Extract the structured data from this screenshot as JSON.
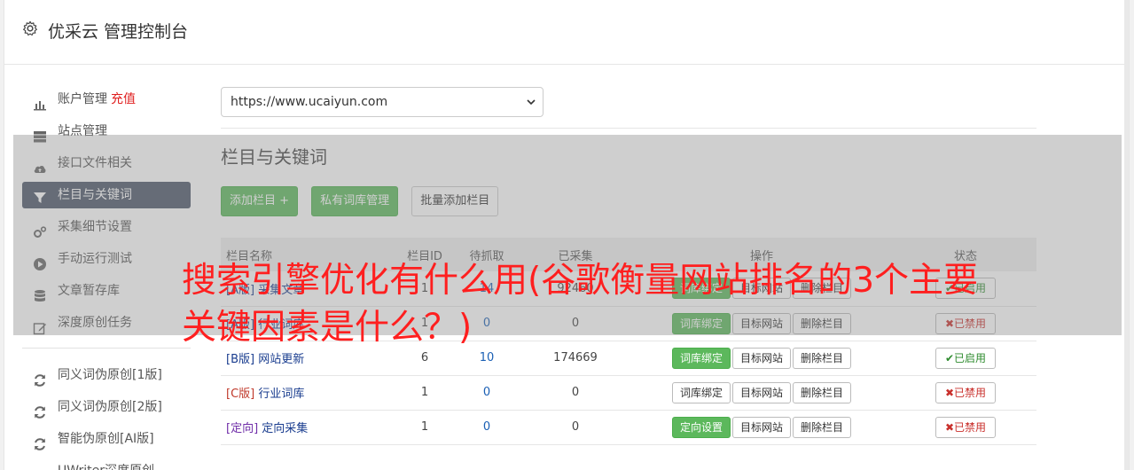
{
  "header": {
    "title": "优采云 管理控制台"
  },
  "sidebar": {
    "items": [
      {
        "label": "账户管理",
        "extra": "充值",
        "icon": "bar-chart-icon"
      },
      {
        "label": "站点管理",
        "icon": "server-icon"
      },
      {
        "label": "接口文件相关",
        "icon": "cloud-upload-icon"
      },
      {
        "label": "栏目与关键词",
        "icon": "filter-icon",
        "active": true
      },
      {
        "label": "采集细节设置",
        "icon": "cogs-icon"
      },
      {
        "label": "手动运行测试",
        "icon": "play-circle-icon"
      },
      {
        "label": "文章暂存库",
        "icon": "database-icon"
      },
      {
        "label": "深度原创任务",
        "icon": "edit-icon"
      }
    ],
    "items2": [
      {
        "label": "同义词伪原创[1版]",
        "icon": "refresh-icon"
      },
      {
        "label": "同义词伪原创[2版]",
        "icon": "refresh-icon"
      },
      {
        "label": "智能伪原创[AI版]",
        "icon": "refresh-icon"
      },
      {
        "label": "UWriter深度原创",
        "icon": "edit-icon"
      }
    ]
  },
  "main": {
    "site_select": "https://www.ucaiyun.com",
    "section_title": "栏目与关键词",
    "buttons": {
      "add": "添加栏目 +",
      "private_lib": "私有词库管理",
      "batch_add": "批量添加栏目"
    },
    "table": {
      "headers": [
        "栏目名称",
        "栏目ID",
        "待抓取",
        "已采集",
        "操作",
        "状态"
      ],
      "rows": [
        {
          "tag": "[A版]",
          "name": "采集文章",
          "id": "1",
          "pending": "14",
          "collected": "92460",
          "op1": "词库绑定",
          "op1_green": true,
          "op2": "目标网站",
          "op3": "删除栏目",
          "status": "✔已启用",
          "on": true
        },
        {
          "tag": "[A版]",
          "name": "行业词库",
          "id": "1",
          "pending": "0",
          "collected": "0",
          "op1": "词库绑定",
          "op1_green": true,
          "op2": "目标网站",
          "op3": "删除栏目",
          "status": "✖已禁用",
          "on": false
        },
        {
          "tag": "[B版]",
          "name": "网站更新",
          "id": "6",
          "pending": "10",
          "collected": "174669",
          "op1": "词库绑定",
          "op1_green": true,
          "op2": "目标网站",
          "op3": "删除栏目",
          "status": "✔已启用",
          "on": true
        },
        {
          "tag": "[C版]",
          "name": "行业词库",
          "id": "1",
          "pending": "0",
          "collected": "0",
          "op1": "词库绑定",
          "op1_green": false,
          "op2": "目标网站",
          "op3": "删除栏目",
          "status": "✖已禁用",
          "on": false
        },
        {
          "tag": "[定向]",
          "name": "定向采集",
          "id": "1",
          "pending": "0",
          "collected": "0",
          "op1": "定向设置",
          "op1_green": true,
          "op2": "目标网站",
          "op3": "删除栏目",
          "status": "✖已禁用",
          "on": false
        }
      ]
    }
  },
  "overlay_text": "搜索引擎优化有什么用(谷歌衡量网站排名的3个主要关键因素是什么？)",
  "colors": {
    "green": "#5cb85c",
    "sidebar_active": "#4a5568",
    "red_text": "#ff1f1f"
  }
}
